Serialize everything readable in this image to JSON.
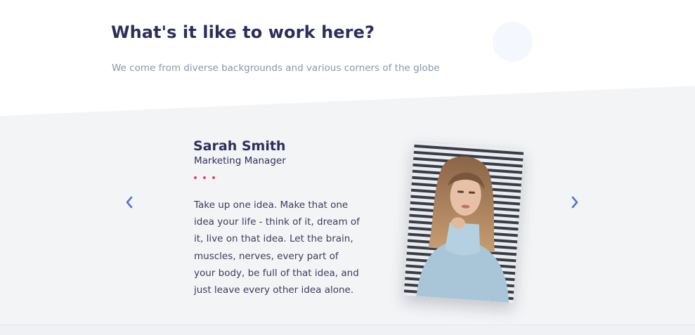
{
  "section": {
    "title": "What's it like to work here?",
    "subtitle": "We come from diverse backgrounds and various corners of the globe"
  },
  "testimonial": {
    "name": "Sarah Smith",
    "role": "Marketing Manager",
    "quote": "Take up one idea. Make that one idea your life - think of it, dream of it, live on that idea. Let the brain, muscles, nerves, every part of your body, be full of that idea, and just leave every other idea alone.",
    "photo": "portrait of woman in light blue turtleneck sweater"
  },
  "navigation": {
    "prev_icon": "chevron-left-icon",
    "next_icon": "chevron-right-icon"
  },
  "colors": {
    "heading": "#2d2f5a",
    "muted": "#8a96aa",
    "accent_dots": "#ea3f5f",
    "arrows": "#5a6fd6",
    "band_bg": "#f3f4f6"
  }
}
